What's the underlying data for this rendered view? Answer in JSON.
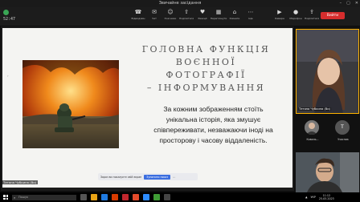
{
  "window": {
    "title": "Звичайне засідання"
  },
  "meeting": {
    "timer": "52:47"
  },
  "toolbar": {
    "items": [
      {
        "label": "Відеодзвін",
        "icon": "phone-icon"
      },
      {
        "label": "Чат",
        "icon": "chat-icon"
      },
      {
        "label": "Учасники",
        "icon": "participants-icon"
      },
      {
        "label": "Поділитися",
        "icon": "share-icon"
      },
      {
        "label": "Реакції",
        "icon": "reaction-icon"
      },
      {
        "label": "Переглянути",
        "icon": "view-icon"
      },
      {
        "label": "Кімнати",
        "icon": "rooms-icon"
      },
      {
        "label": "Ще",
        "icon": "more-icon"
      }
    ],
    "right_items": [
      {
        "label": "Камера",
        "icon": "camera-icon"
      },
      {
        "label": "Мікрофон",
        "icon": "mic-icon"
      },
      {
        "label": "Поділитися",
        "icon": "share-screen-icon"
      }
    ],
    "leave_label": "Вийти"
  },
  "slide": {
    "title_lines": [
      "ГОЛОВНА ФУНКЦІЯ",
      "ВОЄННОЇ ФОТОГРАФІЇ",
      "– ІНФОРМУВАННЯ"
    ],
    "quote_lines": [
      "За кожним зображенням стоїть",
      "унікальна історія, яка змушує",
      "співпереживати, незважаючи іноді на",
      "просторову і часову віддаленість."
    ]
  },
  "share_bar": {
    "text": "Зараз ви показуєте свій екран",
    "stop_label": "Зупинити показ",
    "more_label": "⋯"
  },
  "participants": {
    "main_name": "Тетяна Чубкина (Ви)",
    "small": [
      {
        "name": "Коваль...",
        "initial": ""
      },
      {
        "name": "Учасник",
        "initial": "T"
      }
    ]
  },
  "self_view": {
    "name": "Тетяна Чубкина (Ви)"
  },
  "taskbar": {
    "search_placeholder": "Пошук",
    "lang": "УКР",
    "time": "11:12",
    "date": "25.05.2023"
  },
  "colors": {
    "leave": "#d62d2d",
    "active_border": "#ffb300",
    "share_blue": "#3b6ee0"
  }
}
